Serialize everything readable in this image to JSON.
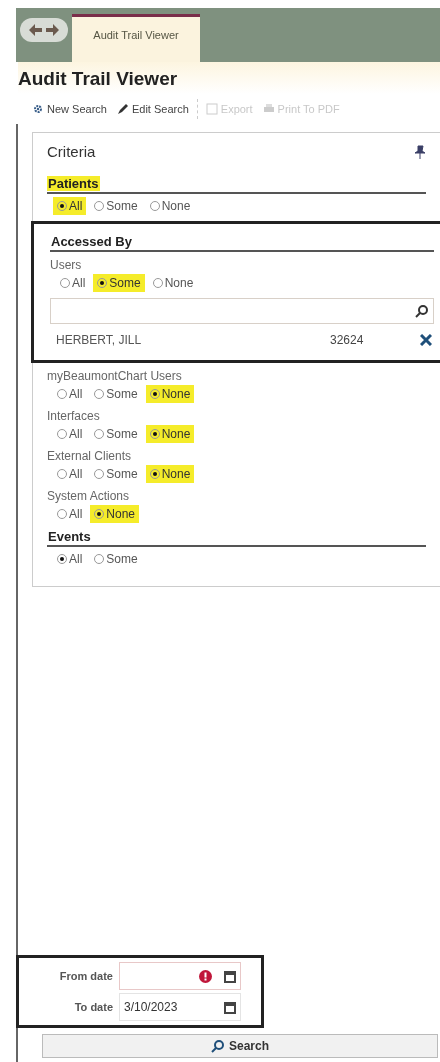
{
  "tab": "Audit Trail Viewer",
  "title": "Audit Trail Viewer",
  "toolbar": [
    {
      "label": "New Search",
      "disabled": false
    },
    {
      "label": "Edit Search",
      "disabled": false
    },
    {
      "label": "Export",
      "disabled": true
    },
    {
      "label": "Print To PDF",
      "disabled": true
    }
  ],
  "criteria": {
    "title": "Criteria",
    "sections": [
      {
        "heading": "Patients",
        "highlighted": true,
        "groups": [
          {
            "options": [
              {
                "label": "All",
                "selected": true,
                "highlighted": true
              },
              {
                "label": "Some",
                "selected": false,
                "highlighted": false
              },
              {
                "label": "None",
                "selected": false,
                "highlighted": false
              }
            ]
          }
        ]
      },
      {
        "heading": "Accessed By",
        "highlighted": false,
        "outlined": true,
        "groups": [
          {
            "label": "Users",
            "options": [
              {
                "label": "All",
                "selected": false,
                "highlighted": false
              },
              {
                "label": "Some",
                "selected": true,
                "highlighted": true
              },
              {
                "label": "None",
                "selected": false,
                "highlighted": false
              }
            ],
            "search": true,
            "entries": [
              {
                "name": "HERBERT, JILL",
                "id": "32624"
              }
            ]
          }
        ]
      },
      {
        "groups": [
          {
            "label": "myBeaumontChart Users",
            "options": [
              {
                "label": "All",
                "selected": false,
                "highlighted": false
              },
              {
                "label": "Some",
                "selected": false,
                "highlighted": false
              },
              {
                "label": "None",
                "selected": true,
                "highlighted": true
              }
            ]
          },
          {
            "label": "Interfaces",
            "options": [
              {
                "label": "All",
                "selected": false,
                "highlighted": false
              },
              {
                "label": "Some",
                "selected": false,
                "highlighted": false
              },
              {
                "label": "None",
                "selected": true,
                "highlighted": true
              }
            ]
          },
          {
            "label": "External Clients",
            "options": [
              {
                "label": "All",
                "selected": false,
                "highlighted": false
              },
              {
                "label": "Some",
                "selected": false,
                "highlighted": false
              },
              {
                "label": "None",
                "selected": true,
                "highlighted": true
              }
            ]
          },
          {
            "label": "System Actions",
            "options": [
              {
                "label": "All",
                "selected": false,
                "highlighted": false
              },
              {
                "label": "None",
                "selected": true,
                "highlighted": true
              }
            ]
          }
        ]
      },
      {
        "heading": "Events",
        "highlighted": false,
        "groups": [
          {
            "options": [
              {
                "label": "All",
                "selected": true,
                "highlighted": false
              },
              {
                "label": "Some",
                "selected": false,
                "highlighted": false
              }
            ]
          }
        ]
      }
    ]
  },
  "dates": [
    {
      "label": "From date",
      "error": true
    },
    {
      "label": "To date",
      "value": "3/10/2023",
      "error": false
    }
  ],
  "search_button": "Search"
}
